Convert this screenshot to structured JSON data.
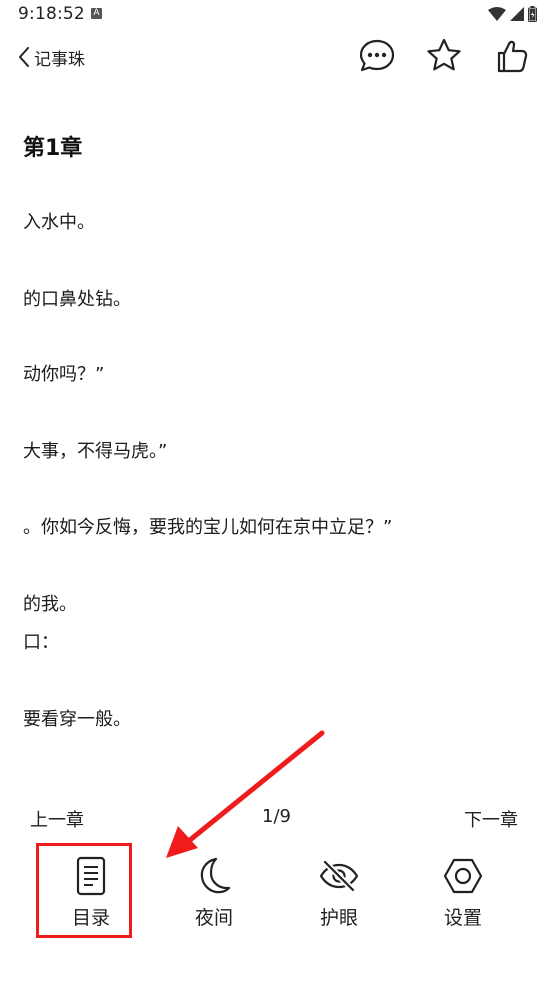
{
  "status_bar": {
    "time": "9:18:52",
    "badge": "A"
  },
  "header": {
    "back_label": "记事珠",
    "icons": [
      "comment-icon",
      "star-icon",
      "thumbs-up-icon"
    ]
  },
  "content": {
    "chapter_title": "第1章",
    "paragraphs": [
      "入水中。",
      "的口鼻处钻。",
      "动你吗？”",
      "大事，不得马虎。”",
      "。你如今反悔，要我的宝儿如何在京中立足？”",
      "的我。",
      "口：",
      "要看穿一般。"
    ]
  },
  "pager": {
    "prev": "上一章",
    "page": "1/9",
    "next": "下一章"
  },
  "toolbar": {
    "items": [
      {
        "label": "目录",
        "icon": "document-list-icon"
      },
      {
        "label": "夜间",
        "icon": "moon-icon"
      },
      {
        "label": "护眼",
        "icon": "eye-off-icon"
      },
      {
        "label": "设置",
        "icon": "hexagon-settings-icon"
      }
    ]
  },
  "annotation": {
    "color": "#ee1c1c"
  }
}
